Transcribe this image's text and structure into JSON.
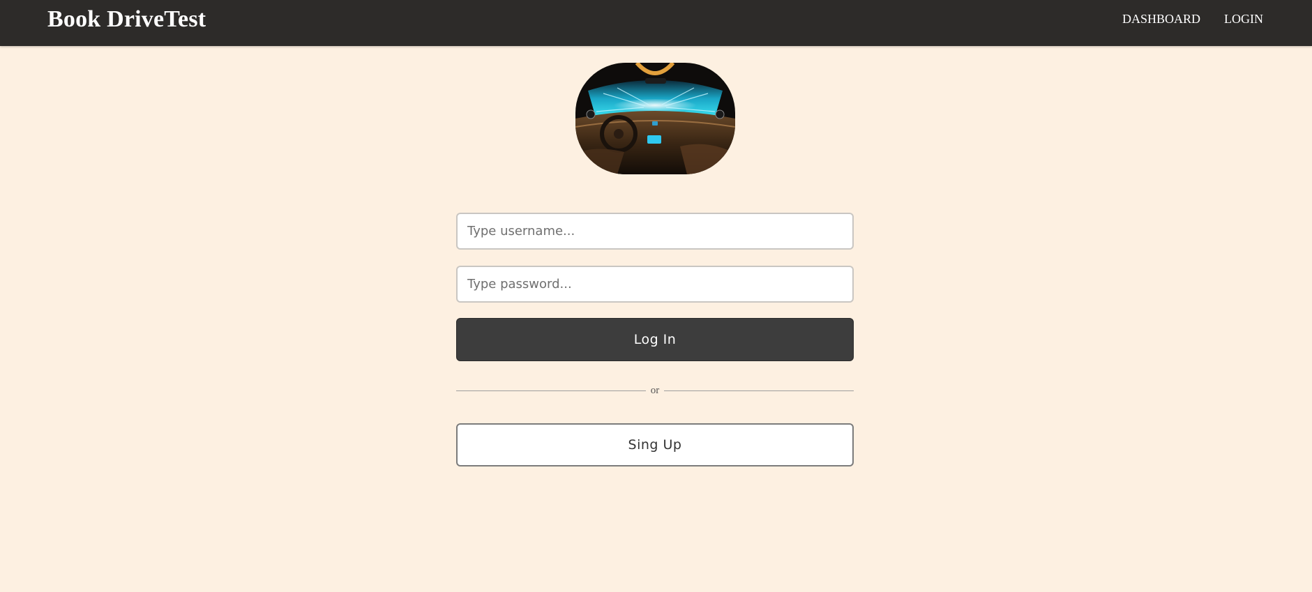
{
  "navbar": {
    "brand": "Book DriveTest",
    "links": [
      {
        "label": "DASHBOARD"
      },
      {
        "label": "LOGIN"
      }
    ]
  },
  "login_form": {
    "username_placeholder": "Type username...",
    "password_placeholder": "Type password...",
    "login_label": "Log In",
    "divider_text": "or",
    "signup_label": "Sing Up"
  },
  "colors": {
    "navbar_bg": "#2d2b29",
    "page_bg": "#fdf0e1",
    "primary_button": "#3d3d3d"
  }
}
